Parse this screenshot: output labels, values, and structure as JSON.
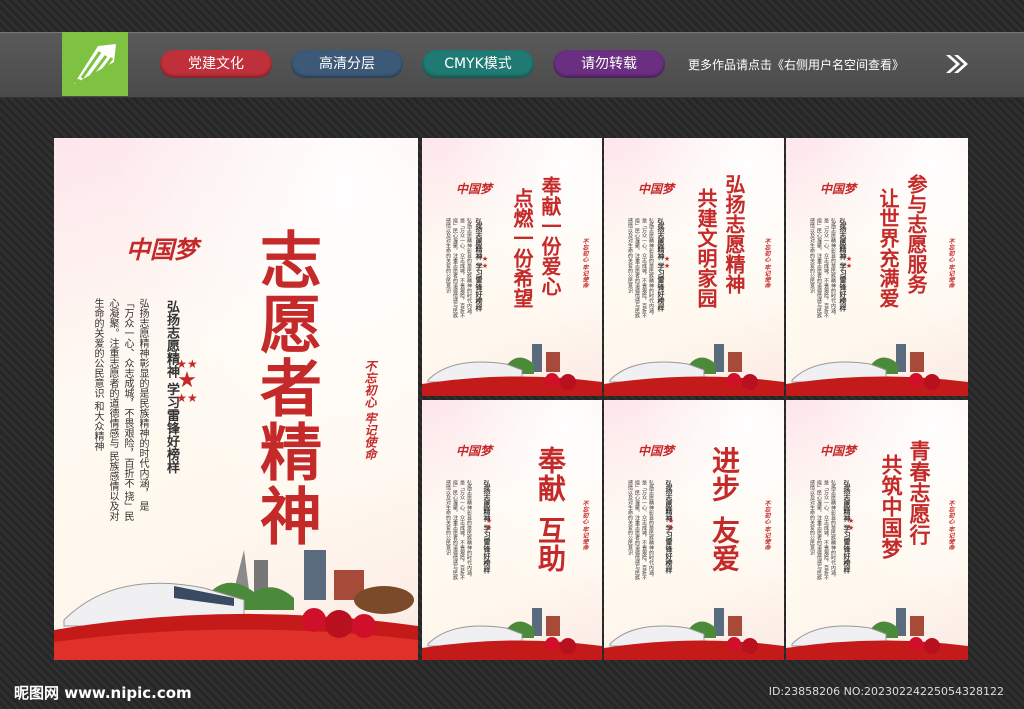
{
  "header": {
    "tags": [
      "党建文化",
      "高清分层",
      "CMYK模式",
      "请勿转载"
    ],
    "note": "更多作品请点击《右侧用户名空间查看》"
  },
  "main_poster": {
    "logo_text": "中国梦",
    "title": "志愿者精神",
    "slogan": "弘扬志愿精神  学习雷锋好榜样",
    "stamp": "不忘初心  牢记使命",
    "body_lines": [
      "弘扬志愿精神彰显的是民族精神的时代内涵，",
      "是「万众一心、众志成城，不畏艰险，百折不",
      "挠」民心凝聚。注重志愿者的道德情感与",
      "民族感情以及对生命的关爱的公民意识",
      "和大众精神"
    ]
  },
  "small_posters": [
    {
      "title_a": "奉献一份爱心",
      "title_b": "点燃一份希望"
    },
    {
      "title_a": "弘扬志愿精神",
      "title_b": "共建文明家园"
    },
    {
      "title_a": "参与志愿服务",
      "title_b": "让世界充满爱"
    },
    {
      "title_a": "奉献",
      "title_b": "互助"
    },
    {
      "title_a": "进步",
      "title_b": "友爱"
    },
    {
      "title_a": "青春志愿行",
      "title_b": "共筑中国梦"
    }
  ],
  "footer": {
    "site": "昵图网 www.nipic.com",
    "id": "ID:23858206 NO:20230224225054328122"
  },
  "colors": {
    "accent": "#c42a2a",
    "logo_green": "#7fc241"
  }
}
